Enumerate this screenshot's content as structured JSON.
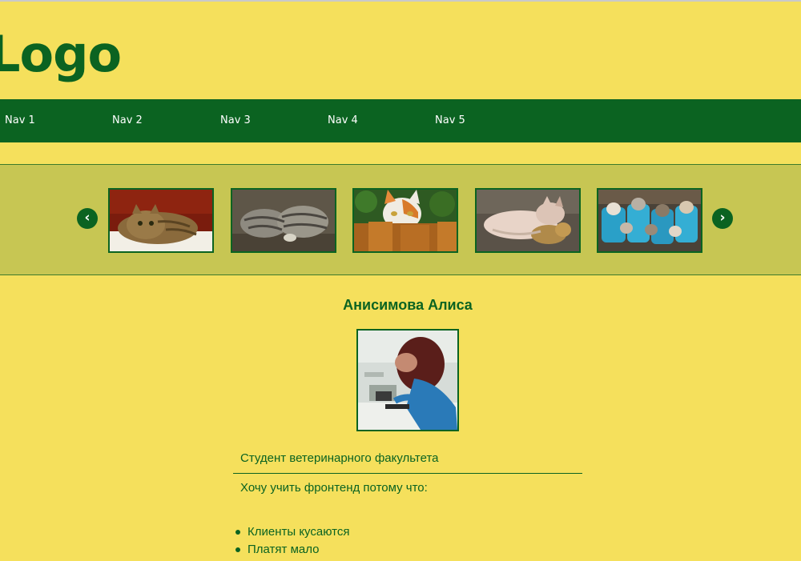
{
  "header": {
    "logo_text": "Logo"
  },
  "nav": {
    "items": [
      {
        "label": "Nav 1"
      },
      {
        "label": "Nav 2"
      },
      {
        "label": "Nav 3"
      },
      {
        "label": "Nav 4"
      },
      {
        "label": "Nav 5"
      }
    ]
  },
  "slider": {
    "prev_label": "‹",
    "next_label": "›",
    "thumbnails": [
      {
        "subject": "cat-lying-red-background"
      },
      {
        "subject": "tabby-cats-sleeping"
      },
      {
        "subject": "calico-cat-behind-fence"
      },
      {
        "subject": "kitten-sleeping-with-toy"
      },
      {
        "subject": "kittens-in-buckets"
      }
    ]
  },
  "profile": {
    "name": "Анисимова Алиса",
    "description": "Студент ветеринарного факультета",
    "why_title": "Хочу учить фронтенд потому что:",
    "reasons": [
      "Клиенты кусаются",
      "Платят мало"
    ]
  },
  "colors": {
    "background": "#f5e05c",
    "primary_green": "#0b6321",
    "slider_band": "#c7c653",
    "nav_text": "#ffffff"
  }
}
